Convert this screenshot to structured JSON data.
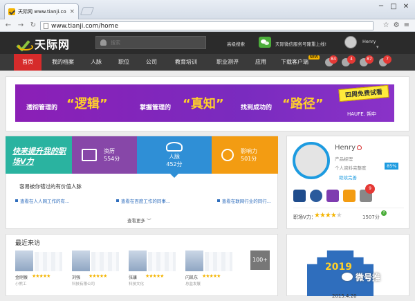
{
  "browser": {
    "tab_title": "天际网 www.tianji.com - ",
    "url": "www.tianji.com/home"
  },
  "header": {
    "logo": "天际网",
    "search_placeholder": "搜索",
    "advanced_search": "高级搜索",
    "wechat_text": "天际微信服务号隆重上线!",
    "username": "Henry"
  },
  "nav": {
    "items": [
      "首页",
      "我的档案",
      "人脉",
      "职位",
      "公司",
      "教育培训",
      "职业测评",
      "应用",
      "下载客户端"
    ],
    "new_badge": "NEW",
    "counts": [
      "84",
      "4",
      "87",
      "7"
    ]
  },
  "banner": {
    "p1": "透彻管理的",
    "q1": "“逻辑”",
    "p2": "掌握管理的",
    "q2": "“真知”",
    "p3": "找到成功的",
    "q3": "“路径”",
    "trial": "四周免费试看",
    "brand": "HAUFE. 朔中"
  },
  "dashboard": {
    "promo": "快来提升我的职场V力",
    "metrics": [
      {
        "label": "资历",
        "value": "554分"
      },
      {
        "label": "人脉",
        "value": "452分"
      },
      {
        "label": "影响力",
        "value": "501分"
      }
    ],
    "recommend_title": "容易被你错过的有价值人脉",
    "links": [
      "查看在人人网工作的有...",
      "查看在百度工作的同事...",
      "查看在联网行业的同行..."
    ],
    "more": "查看更多 ﹀"
  },
  "visitors": {
    "title": "最近来访",
    "items": [
      {
        "name": "金刚猴",
        "sub": "小熊工"
      },
      {
        "name": "刘强",
        "sub": "科技有限公司"
      },
      {
        "name": "张康",
        "sub": "科技文化"
      },
      {
        "name": "闪凯东",
        "sub": "总监发展"
      }
    ],
    "more": "100+"
  },
  "profile": {
    "name": "Henry",
    "title": "产品经理",
    "completeness_label": "个人资料完整度",
    "completeness": "85%",
    "continue": "继续完善",
    "badge_count": "9",
    "v_label": "职场V力：",
    "v_rating": 4,
    "v_score": "1507分",
    "v_help": "?"
  },
  "event": {
    "number": "2019",
    "date": "2015.4.20"
  },
  "watermark": "微号推",
  "colors": {
    "accent": "#d62b2b",
    "teal": "#2ab3a0",
    "purple": "#8747a8",
    "blue": "#2f8fd6",
    "orange": "#f39c12"
  }
}
